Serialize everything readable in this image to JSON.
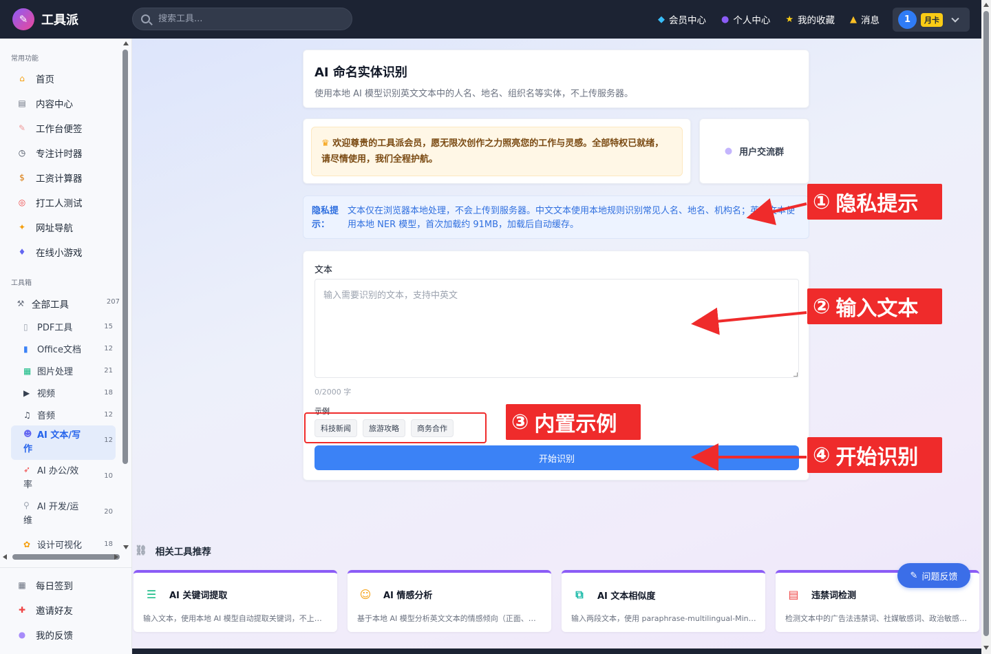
{
  "app": {
    "name": "工具派"
  },
  "search": {
    "placeholder": "搜索工具..."
  },
  "topnav": {
    "items": [
      {
        "label": "会员中心",
        "icon": "diamond-icon"
      },
      {
        "label": "个人中心",
        "icon": "user-icon"
      },
      {
        "label": "我的收藏",
        "icon": "star-icon"
      },
      {
        "label": "消息",
        "icon": "bell-icon"
      }
    ],
    "user": {
      "avatar_text": "1",
      "badge": "月卡"
    }
  },
  "sidebar": {
    "section_common": "常用功能",
    "common": [
      {
        "label": "首页",
        "icon": "home-icon"
      },
      {
        "label": "内容中心",
        "icon": "news-icon"
      },
      {
        "label": "工作台便签",
        "icon": "memo-icon"
      },
      {
        "label": "专注计时器",
        "icon": "timer-icon"
      },
      {
        "label": "工资计算器",
        "icon": "money-bag-icon"
      },
      {
        "label": "打工人测试",
        "icon": "target-icon"
      },
      {
        "label": "网址导航",
        "icon": "compass-icon"
      },
      {
        "label": "在线小游戏",
        "icon": "gamepad-icon"
      }
    ],
    "section_tools": "工具箱",
    "all_tools": {
      "label": "全部工具",
      "count": "207"
    },
    "tools": [
      {
        "label": "PDF工具",
        "count": "15"
      },
      {
        "label": "Office文档",
        "count": "12"
      },
      {
        "label": "图片处理",
        "count": "21"
      },
      {
        "label": "视频",
        "count": "18"
      },
      {
        "label": "音频",
        "count": "12"
      },
      {
        "label_1": "AI 文本/写",
        "label_2": "作",
        "count": "12"
      },
      {
        "label_1": "AI 办公/效",
        "label_2": "率",
        "count": "10"
      },
      {
        "label_1": "AI 开发/运",
        "label_2": "维",
        "count": "20"
      },
      {
        "label": "设计可视化",
        "count": "18"
      }
    ],
    "bottom": [
      {
        "label": "每日签到"
      },
      {
        "label": "邀请好友"
      },
      {
        "label": "我的反馈"
      }
    ]
  },
  "page": {
    "title": "AI 命名实体识别",
    "subtitle": "使用本地 AI 模型识别英文文本中的人名、地名、组织名等实体，不上传服务器。",
    "welcome": "欢迎尊贵的工具派会员，愿无限次创作之力照亮您的工作与灵感。全部特权已就绪，请尽情使用，我们全程护航。",
    "group_label": "用户交流群",
    "privacy_label": "隐私提示：",
    "privacy_text": "文本仅在浏览器本地处理，不会上传到服务器。中文文本使用本地规则识别常见人名、地名、机构名；英文文本使用本地 NER 模型，首次加载约 91MB，加载后自动缓存。",
    "text_label": "文本",
    "text_placeholder": "输入需要识别的文本，支持中英文",
    "counter": "0/2000 字",
    "examples_label": "示例",
    "examples": [
      "科技新闻",
      "旅游攻略",
      "商务合作"
    ],
    "submit_label": "开始识别"
  },
  "related": {
    "title": "相关工具推荐",
    "cards": [
      {
        "title": "AI 关键词提取",
        "desc": "输入文本，使用本地 AI 模型自动提取关键词，不上传服务器。",
        "icon": "keyword-icon"
      },
      {
        "title": "AI 情感分析",
        "desc": "基于本地 AI 模型分析英文文本的情感倾向（正面、负面）。",
        "icon": "smile-icon"
      },
      {
        "title": "AI 文本相似度",
        "desc": "输入两段文本，使用 paraphrase-multilingual-MiniLM 模型计算相似度。",
        "icon": "compare-icon"
      },
      {
        "title": "违禁词检测",
        "desc": "检测文本中的广告法违禁词、社媒敏感词、政治敏感词等。",
        "icon": "check-doc-icon"
      }
    ],
    "feedback_label": "问题反馈"
  },
  "annotations": [
    {
      "num": "①",
      "text": "隐私提示"
    },
    {
      "num": "②",
      "text": "输入文本"
    },
    {
      "num": "③",
      "text": "内置示例"
    },
    {
      "num": "④",
      "text": "开始识别"
    }
  ]
}
